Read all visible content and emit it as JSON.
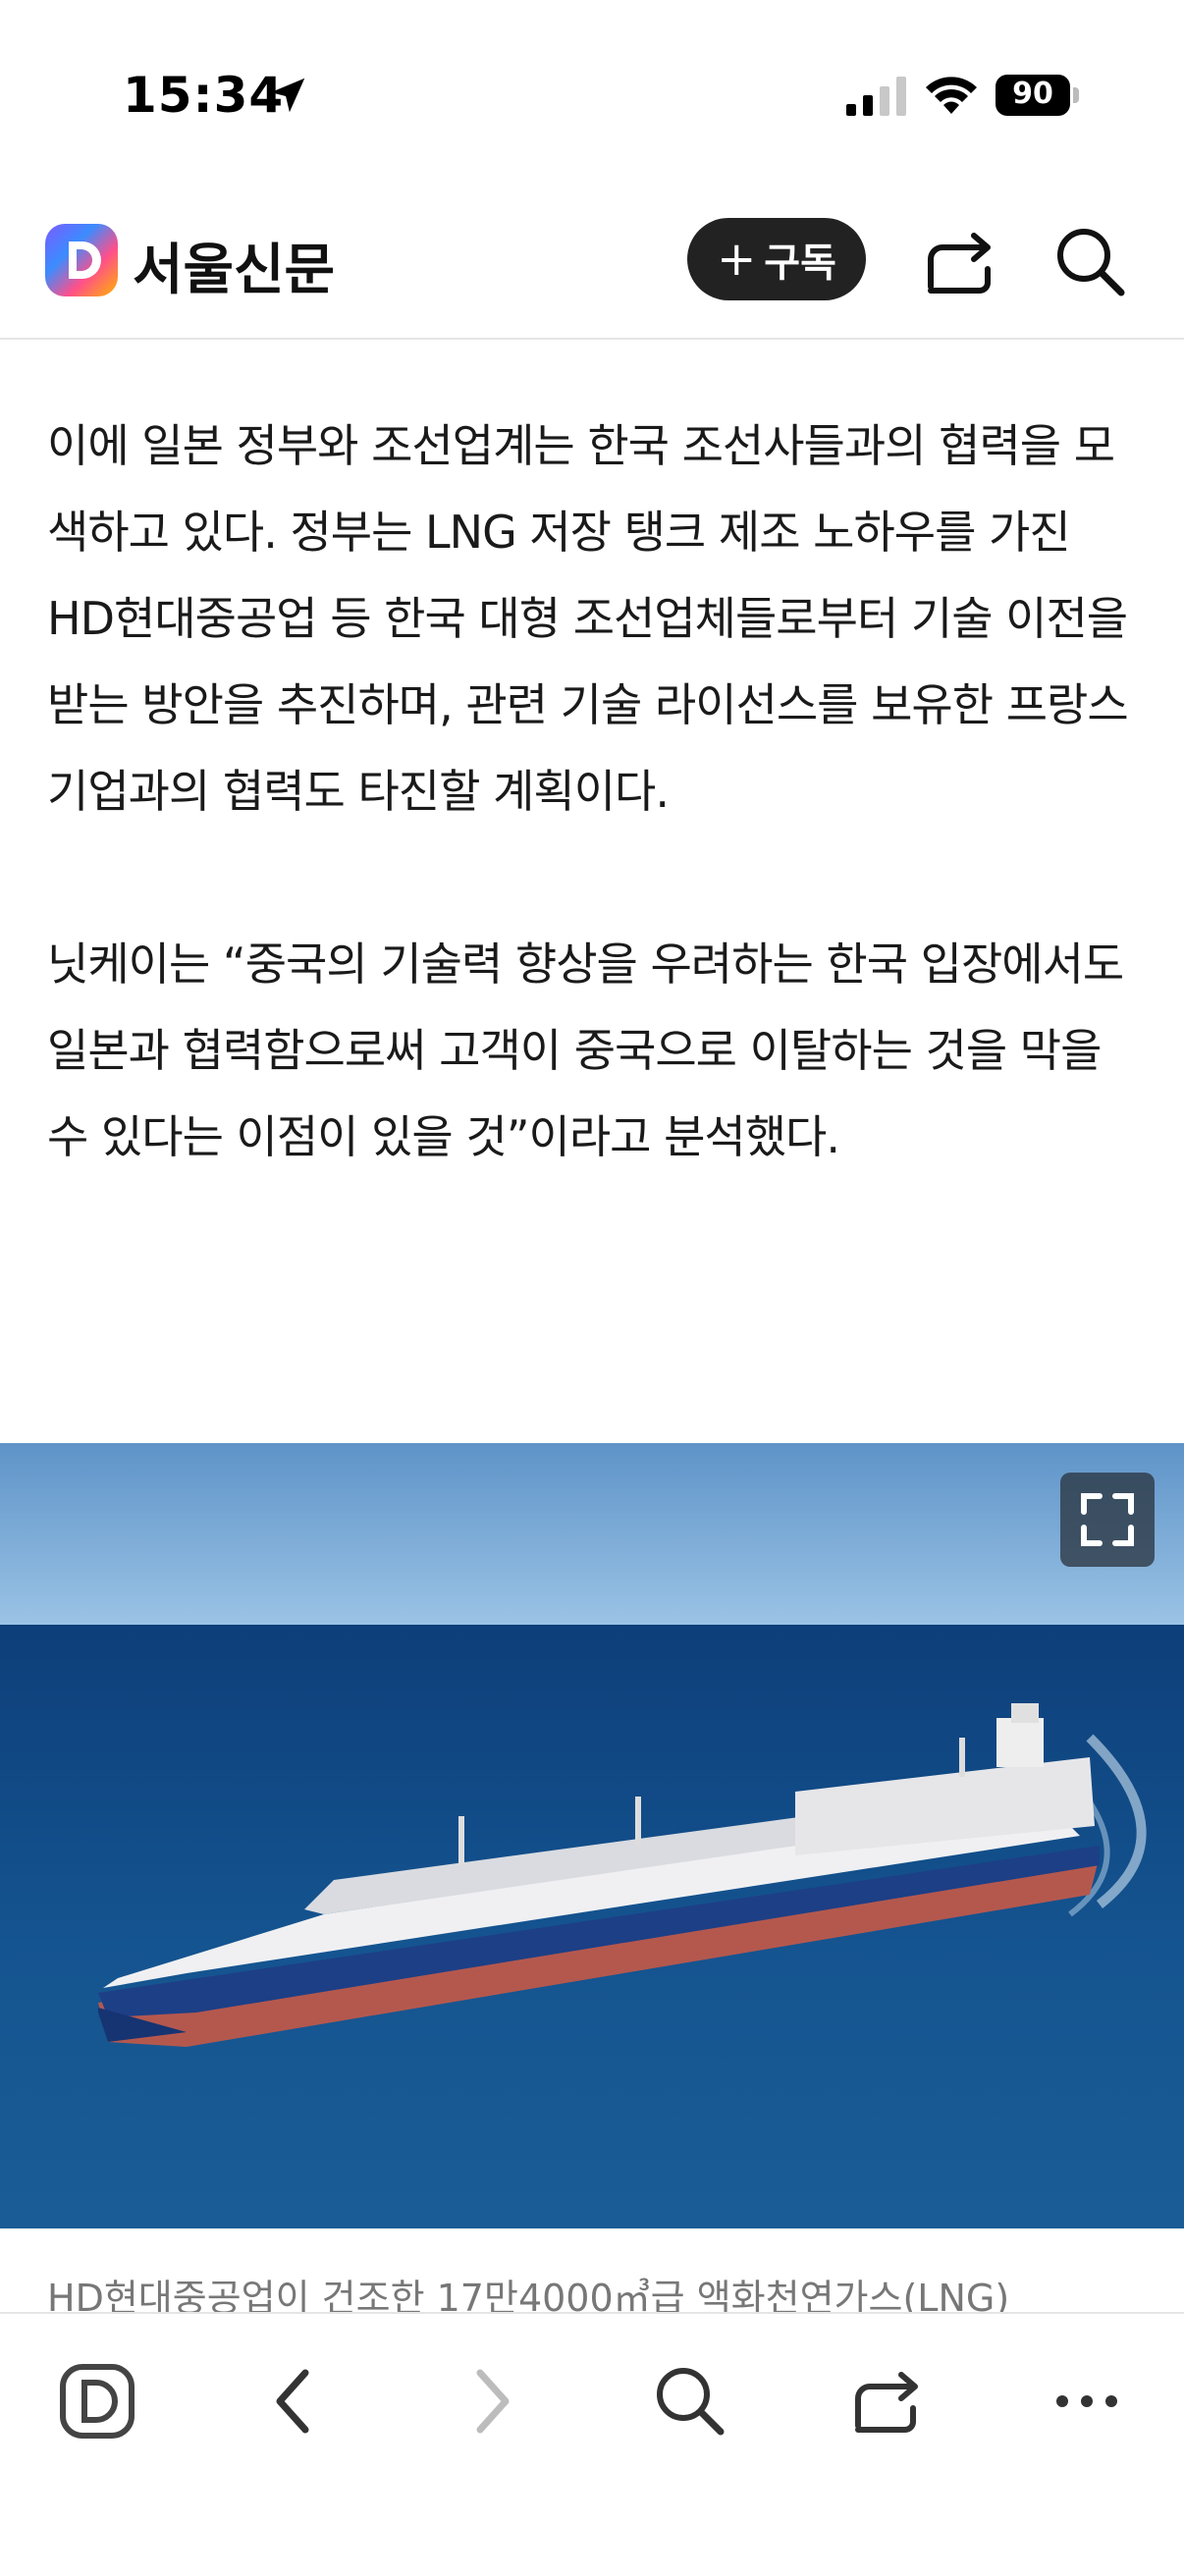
{
  "status_bar": {
    "time": "15:34",
    "battery": "90"
  },
  "header": {
    "paper_name": "서울신문",
    "subscribe_label": "구독"
  },
  "article": {
    "paragraphs": [
      "이에 일본 정부와 조선업계는 한국 조선사들과의 협력을 모색하고 있다. 정부는 LNG 저장 탱크 제조 노하우를 가진 HD현대중공업 등 한국 대형 조선업체들로부터 기술 이전을 받는 방안을 추진하며, 관련 기술 라이선스를 보유한 프랑스 기업과의 협력도 타진할 계획이다.",
      "닛케이는 “중국의 기술력 향상을 우려하는 한국 입장에서도 일본과 협력함으로써 고객이 중국으로 이탈하는 것을 막을 수 있다는 이점이 있을 것”이라고 분석했다."
    ],
    "photo_caption": "HD현대중공업이 건조한 17만4000㎥급 액화천연가스(LNG)"
  },
  "colors": {
    "accent_dark": "#222222",
    "text": "#1a1a1a",
    "caption": "#777777"
  },
  "icons": [
    "location-arrow-icon",
    "signal-icon",
    "wifi-icon",
    "battery-icon",
    "daum-d-logo",
    "share-icon",
    "search-icon",
    "expand-icon",
    "back-icon",
    "forward-icon",
    "more-icon"
  ]
}
